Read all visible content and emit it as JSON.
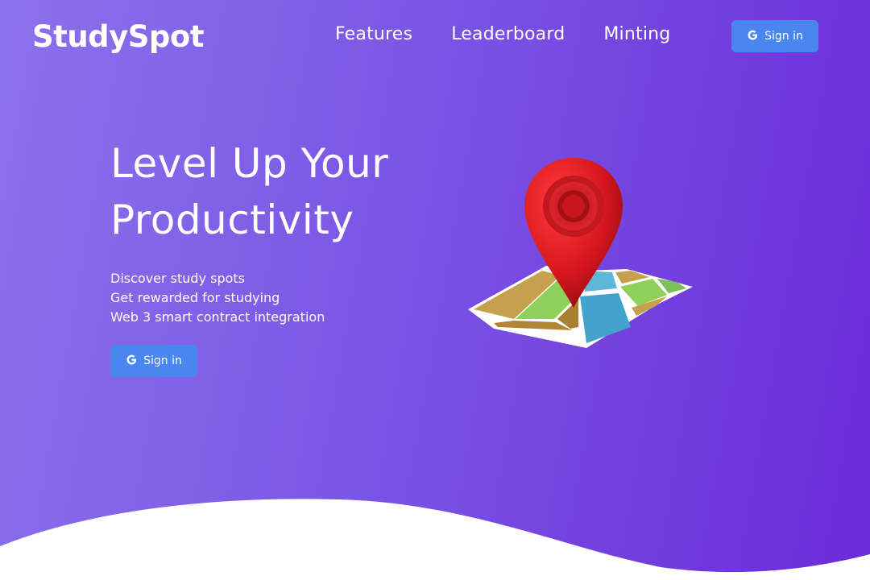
{
  "brand": {
    "name": "StudySpot"
  },
  "nav": {
    "links": [
      "Features",
      "Leaderboard",
      "Minting"
    ],
    "signin_label": "Sign in"
  },
  "hero": {
    "title_line1": "Level Up Your",
    "title_line2": "Productivity",
    "features": [
      "Discover study spots",
      "Get rewarded for studying",
      "Web 3 smart contract integration"
    ],
    "signin_label": "Sign in"
  },
  "icons": {
    "signin": "google-g-icon",
    "illustration": "map-pin-illustration"
  },
  "colors": {
    "gradient_start": "#8b72ec",
    "gradient_end": "#6b2bd9",
    "button": "#4a86f0",
    "pin": "#d6161e"
  }
}
